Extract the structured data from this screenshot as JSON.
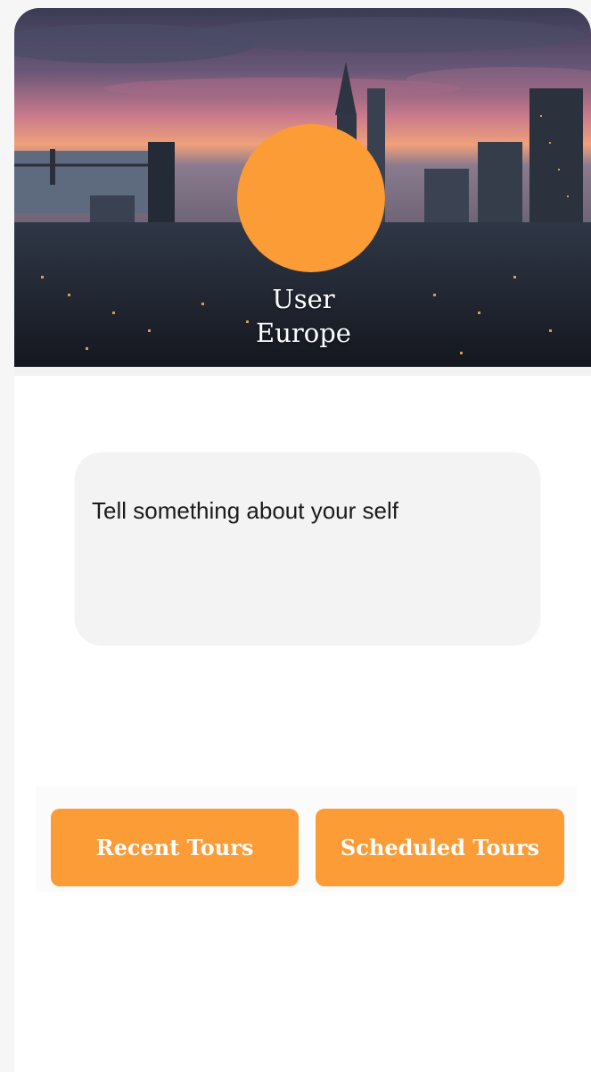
{
  "profile": {
    "name": "User",
    "region": "Europe",
    "avatar_color": "#fb9c36"
  },
  "about": {
    "placeholder": "Tell something about your self"
  },
  "buttons": {
    "recent_label": "Recent Tours",
    "scheduled_label": "Scheduled Tours"
  },
  "header": {
    "image": "city-skyline-at-sunset"
  },
  "colors": {
    "accent": "#fb9c36",
    "field_bg": "#f3f3f3"
  }
}
